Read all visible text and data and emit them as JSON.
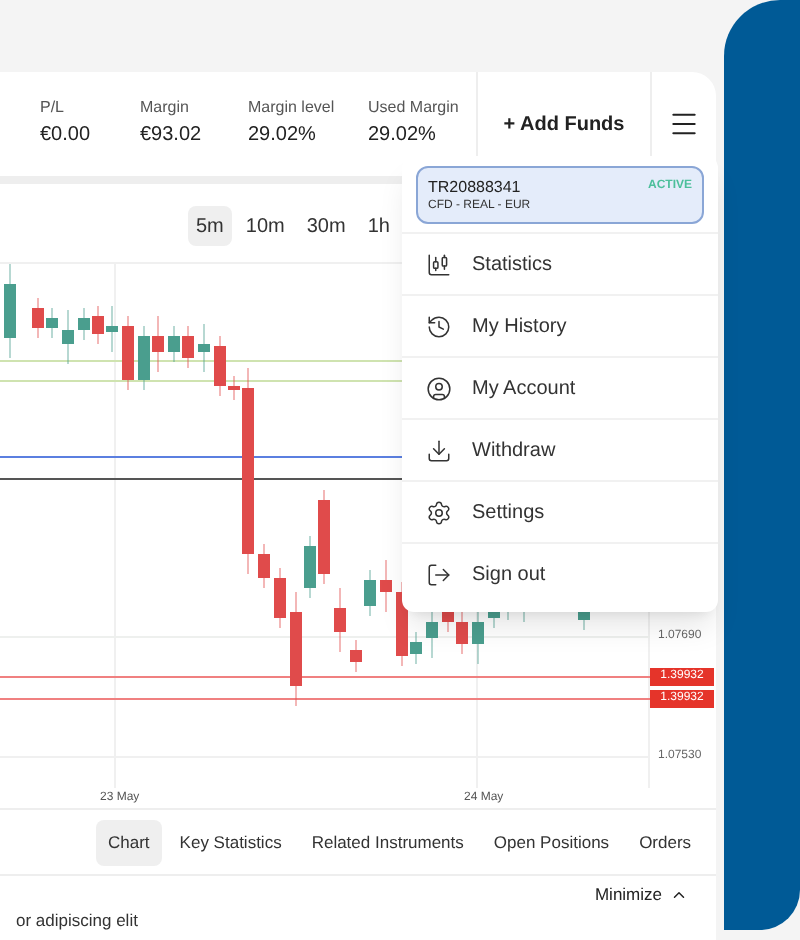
{
  "header": {
    "stats": [
      {
        "label": "P/L",
        "value": "€0.00"
      },
      {
        "label": "Margin",
        "value": "€93.02"
      },
      {
        "label": "Margin level",
        "value": "29.02%"
      },
      {
        "label": "Used Margin",
        "value": "29.02%"
      }
    ],
    "add_funds": "+ Add Funds"
  },
  "timeframes": [
    {
      "label": "5m",
      "selected": true
    },
    {
      "label": "10m",
      "selected": false
    },
    {
      "label": "30m",
      "selected": false
    },
    {
      "label": "1h",
      "selected": false
    }
  ],
  "chart": {
    "price_labels": [
      "1.07690",
      "1.07530"
    ],
    "price_tags": [
      "1.39932",
      "1.39932"
    ],
    "date_labels": [
      "23 May",
      "24 May"
    ]
  },
  "tabs": [
    {
      "label": "Chart",
      "selected": true
    },
    {
      "label": "Key Statistics",
      "selected": false
    },
    {
      "label": "Related Instruments",
      "selected": false
    },
    {
      "label": "Open Positions",
      "selected": false
    },
    {
      "label": "Orders",
      "selected": false
    }
  ],
  "footer": {
    "minimize": "Minimize",
    "text": "or adipiscing elit"
  },
  "menu": {
    "account": {
      "id": "TR20888341",
      "type": "CFD - REAL - EUR",
      "status": "ACTIVE"
    },
    "items": [
      {
        "label": "Statistics"
      },
      {
        "label": "My History"
      },
      {
        "label": "My Account"
      },
      {
        "label": "Withdraw"
      },
      {
        "label": "Settings"
      },
      {
        "label": "Sign out"
      }
    ]
  }
}
